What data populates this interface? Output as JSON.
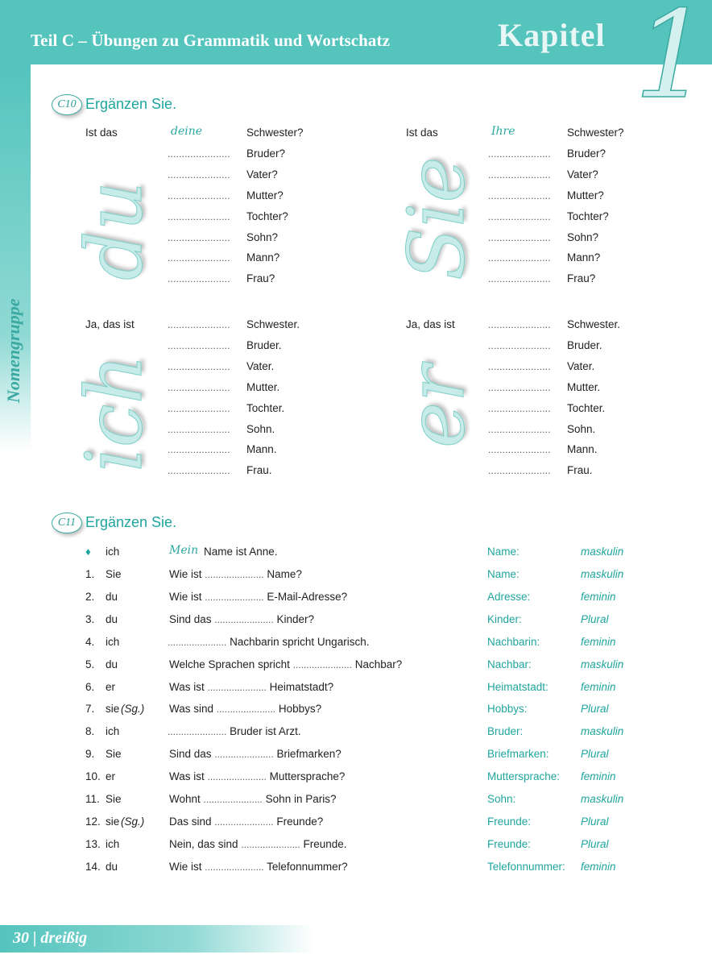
{
  "header": {
    "title": "Teil C – Übungen zu Grammatik und Wortschatz",
    "kapitel": "Kapitel",
    "number": "1"
  },
  "sidebar": {
    "label": "Nomengruppe"
  },
  "footer": {
    "page": "30 | dreißig"
  },
  "c10": {
    "badge": "C10",
    "title": "Ergänzen Sie.",
    "dots": "......................",
    "left_top": {
      "lead": "Ist das",
      "example": "deine",
      "pronoun": "du",
      "nouns": [
        "Schwester?",
        "Bruder?",
        "Vater?",
        "Mutter?",
        "Tochter?",
        "Sohn?",
        "Mann?",
        "Frau?"
      ]
    },
    "right_top": {
      "lead": "Ist das",
      "example": "Ihre",
      "pronoun": "Sie",
      "nouns": [
        "Schwester?",
        "Bruder?",
        "Vater?",
        "Mutter?",
        "Tochter?",
        "Sohn?",
        "Mann?",
        "Frau?"
      ]
    },
    "left_bottom": {
      "lead": "Ja, das ist",
      "pronoun": "ich",
      "nouns": [
        "Schwester.",
        "Bruder.",
        "Vater.",
        "Mutter.",
        "Tochter.",
        "Sohn.",
        "Mann.",
        "Frau."
      ]
    },
    "right_bottom": {
      "lead": "Ja, das ist",
      "pronoun": "er",
      "nouns": [
        "Schwester.",
        "Bruder.",
        "Vater.",
        "Mutter.",
        "Tochter.",
        "Sohn.",
        "Mann.",
        "Frau."
      ]
    }
  },
  "c11": {
    "badge": "C11",
    "title": "Ergänzen Sie.",
    "example": {
      "marker": "♦",
      "pronoun": "ich",
      "answer": "Mein",
      "rest": "Name ist Anne.",
      "noun": "Name:",
      "gender": "maskulin"
    },
    "rows": [
      {
        "num": "1.",
        "pronoun": "Sie",
        "before": "Wie ist",
        "after": "Name?",
        "noun": "Name:",
        "gender": "maskulin"
      },
      {
        "num": "2.",
        "pronoun": "du",
        "before": "Wie ist",
        "after": "E-Mail-Adresse?",
        "noun": "Adresse:",
        "gender": "feminin"
      },
      {
        "num": "3.",
        "pronoun": "du",
        "before": "Sind das",
        "after": "Kinder?",
        "noun": "Kinder:",
        "gender": "Plural"
      },
      {
        "num": "4.",
        "pronoun": "ich",
        "before": "",
        "after": "Nachbarin spricht Ungarisch.",
        "noun": "Nachbarin:",
        "gender": "feminin"
      },
      {
        "num": "5.",
        "pronoun": "du",
        "before": "Welche Sprachen spricht",
        "after": "Nachbar?",
        "noun": "Nachbar:",
        "gender": "maskulin"
      },
      {
        "num": "6.",
        "pronoun": "er",
        "before": "Was ist",
        "after": "Heimatstadt?",
        "noun": "Heimatstadt:",
        "gender": "feminin"
      },
      {
        "num": "7.",
        "pronoun": "sie",
        "pronoun_note": "(Sg.)",
        "before": "Was sind",
        "after": "Hobbys?",
        "noun": "Hobbys:",
        "gender": "Plural"
      },
      {
        "num": "8.",
        "pronoun": "ich",
        "before": "",
        "after": "Bruder ist Arzt.",
        "noun": "Bruder:",
        "gender": "maskulin"
      },
      {
        "num": "9.",
        "pronoun": "Sie",
        "before": "Sind das",
        "after": "Briefmarken?",
        "noun": "Briefmarken:",
        "gender": "Plural"
      },
      {
        "num": "10.",
        "pronoun": "er",
        "before": "Was ist",
        "after": "Muttersprache?",
        "noun": "Muttersprache:",
        "gender": "feminin"
      },
      {
        "num": "11.",
        "pronoun": "Sie",
        "before": "Wohnt",
        "after": "Sohn in Paris?",
        "noun": "Sohn:",
        "gender": "maskulin"
      },
      {
        "num": "12.",
        "pronoun": "sie",
        "pronoun_note": "(Sg.)",
        "before": "Das sind",
        "after": "Freunde?",
        "noun": "Freunde:",
        "gender": "Plural"
      },
      {
        "num": "13.",
        "pronoun": "ich",
        "before": "Nein, das sind",
        "after": "Freunde.",
        "noun": "Freunde:",
        "gender": "Plural"
      },
      {
        "num": "14.",
        "pronoun": "du",
        "before": "Wie ist",
        "after": "Telefonnummer?",
        "noun": "Telefonnummer:",
        "gender": "feminin"
      }
    ]
  }
}
